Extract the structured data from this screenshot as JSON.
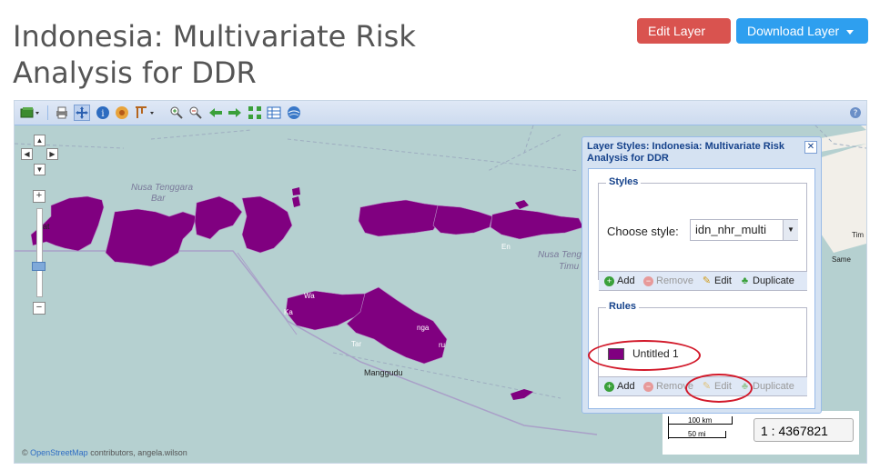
{
  "page": {
    "title": "Indonesia: Multivariate Risk Analysis for DDR"
  },
  "header_buttons": {
    "edit_layer": "Edit Layer",
    "download_layer": "Download Layer"
  },
  "toolbar": {
    "icons": [
      "layers-icon",
      "print-icon",
      "pan-icon",
      "info-icon",
      "measure-icon",
      "query-icon",
      "zoom-in-icon",
      "zoom-out-icon",
      "back-icon",
      "forward-icon",
      "zoom-extent-icon",
      "table-icon",
      "globe-icon",
      "help-icon"
    ]
  },
  "map": {
    "place_labels": {
      "nusa_tenggara_barat": "Nusa Tenggara\nBarat",
      "nusa_tenggara_timur": "Nusa Tenggara\nTimur",
      "manggudu": "Manggudu",
      "bat": "Bat",
      "timur_suffix": "Timu",
      "en": "En",
      "same": "Same",
      "timor": "Tim",
      "wa": "Wa",
      "ka": "Ka",
      "tar": "Tar",
      "nga": "nga",
      "ru": "ru"
    },
    "zoom_in": "+",
    "zoom_out": "−",
    "attribution_osm": "OpenStreetMap",
    "attribution_rest": "contributors, angela.wilson",
    "attribution_prefix": "©",
    "scale_km": "100 km",
    "scale_mi": "50 mi",
    "scale_value": "1 : 4367821",
    "colors": {
      "sea": "#b5d0d0",
      "land": "#f2efe9",
      "layer_fill": "#800080",
      "boundary": "#9e9ec8"
    }
  },
  "layer_styles_panel": {
    "title": "Layer Styles: Indonesia: Multivariate Risk Analysis for DDR",
    "styles_legend": "Styles",
    "choose_style_label": "Choose style:",
    "selected_style": "idn_nhr_multi",
    "rules_legend": "Rules",
    "rule_name": "Untitled 1",
    "styles_buttons": {
      "add": "Add",
      "remove": "Remove",
      "edit": "Edit",
      "duplicate": "Duplicate"
    },
    "rules_buttons": {
      "add": "Add",
      "remove": "Remove",
      "edit": "Edit",
      "duplicate": "Duplicate"
    }
  }
}
